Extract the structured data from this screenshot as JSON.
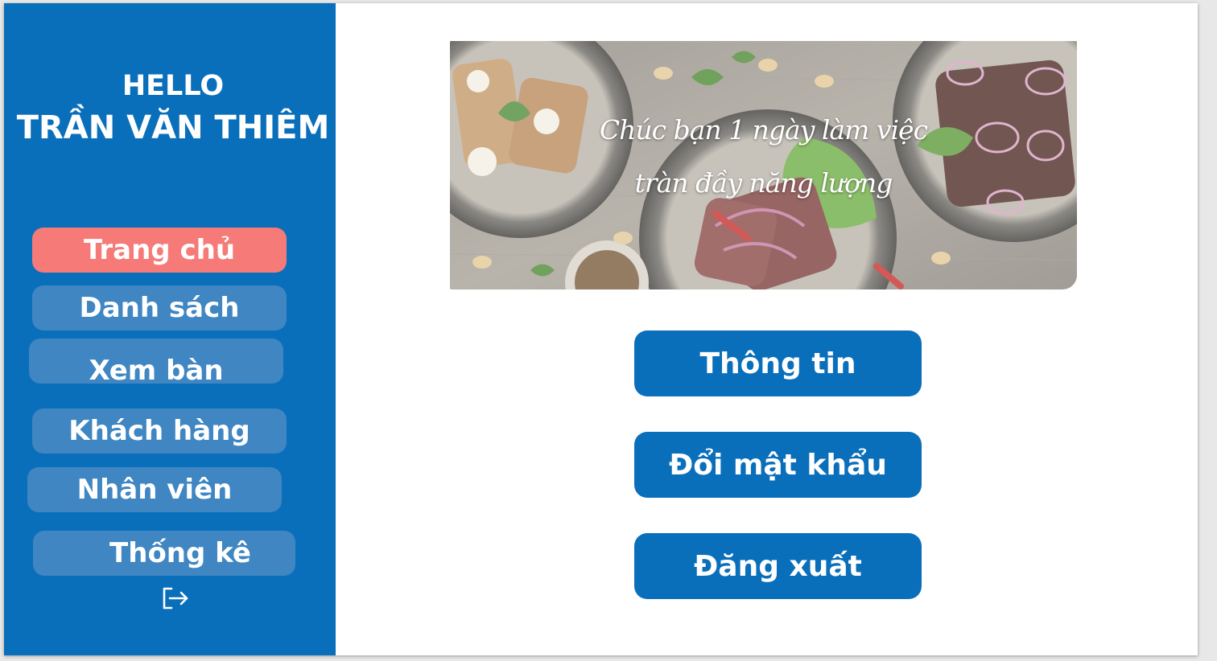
{
  "greeting": {
    "hello": "HELLO",
    "name": "TRẦN VĂN THIÊM"
  },
  "sidebar": {
    "items": [
      {
        "label": "Trang chủ",
        "active": true
      },
      {
        "label": "Danh sách",
        "active": false
      },
      {
        "label": "Xem bàn",
        "active": false
      },
      {
        "label": "Khách hàng",
        "active": false
      },
      {
        "label": "Nhân viên",
        "active": false
      },
      {
        "label": "Thống kê",
        "active": false
      }
    ],
    "logout_icon": "logout-icon"
  },
  "banner": {
    "line1": "Chúc bạn 1 ngày làm việc",
    "line2": "tràn đầy năng lượng"
  },
  "actions": {
    "info": "Thông tin",
    "change_password": "Đổi mật khẩu",
    "logout": "Đăng xuất"
  },
  "colors": {
    "primary": "#0a6fbb",
    "nav_item": "#3f86c2",
    "nav_active": "#f57a78"
  }
}
